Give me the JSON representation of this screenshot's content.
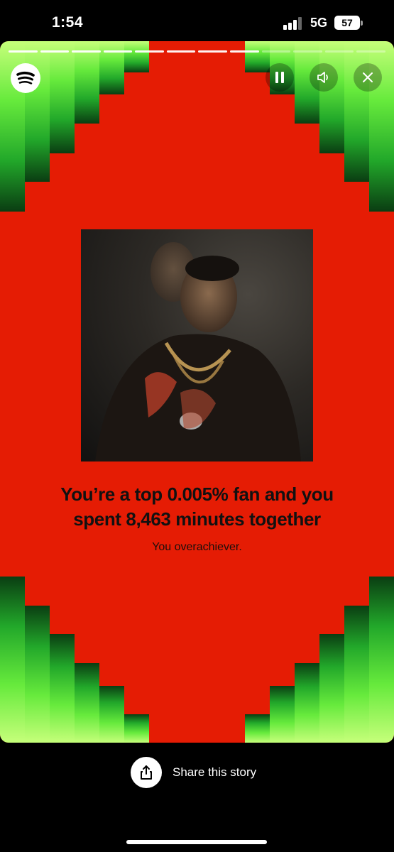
{
  "status_bar": {
    "time": "1:54",
    "network": "5G",
    "battery": "57"
  },
  "story": {
    "progress_total_segments": 12,
    "progress_completed_segments": 8,
    "headline_line1": "You’re a top 0.005% fan and you",
    "headline_line2": "spent 8,463 minutes together",
    "subtext": "You overachiever.",
    "colors": {
      "background": "#e51c04",
      "accent_light": "#c6ff7a",
      "accent_mid": "#66ea3c",
      "accent_dark": "#0a3d12"
    },
    "icons": {
      "logo": "spotify-logo-icon",
      "pause": "pause-icon",
      "sound": "speaker-icon",
      "close": "close-icon"
    }
  },
  "share": {
    "label": "Share this story",
    "icon": "share-icon"
  }
}
